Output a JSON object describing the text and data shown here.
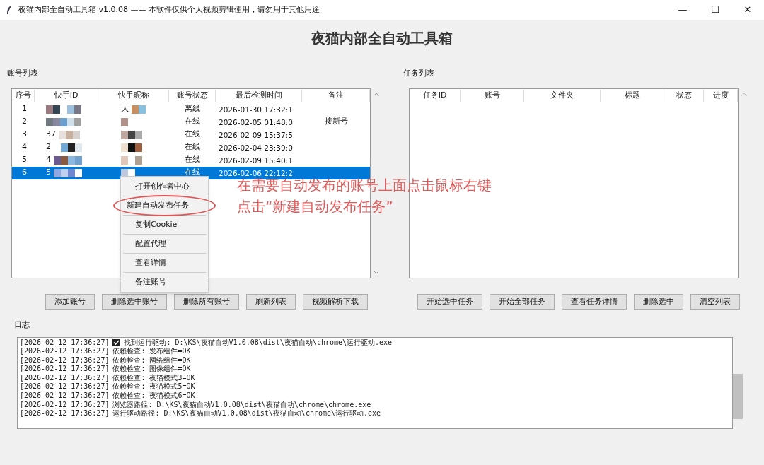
{
  "window": {
    "title": "夜猫内部全自动工具箱 v1.0.08 —— 本软件仅供个人视频剪辑使用，请勿用于其他用途",
    "controls": [
      "—",
      "☐",
      "✕"
    ]
  },
  "heading": "夜猫内部全自动工具箱",
  "accounts": {
    "label": "账号列表",
    "columns": [
      "序号",
      "快手ID",
      "快手昵称",
      "账号状态",
      "最后检测时间",
      "备注"
    ],
    "rows": [
      {
        "index": "1",
        "id_fragment": "",
        "nick_fragment": "大",
        "status": "离线",
        "time": "2026-01-30 17:32:1",
        "note": "",
        "selected": false
      },
      {
        "index": "2",
        "id_fragment": "",
        "nick_fragment": "",
        "status": "在线",
        "time": "2026-02-05 01:48:0",
        "note": "接新号",
        "selected": false
      },
      {
        "index": "3",
        "id_fragment": "37",
        "nick_fragment": "",
        "status": "在线",
        "time": "2026-02-09 15:37:5",
        "note": "",
        "selected": false
      },
      {
        "index": "4",
        "id_fragment": "2",
        "nick_fragment": "",
        "status": "在线",
        "time": "2026-02-04 23:39:0",
        "note": "",
        "selected": false
      },
      {
        "index": "5",
        "id_fragment": "4",
        "nick_fragment": "",
        "status": "在线",
        "time": "2026-02-09 15:40:1",
        "note": "",
        "selected": false
      },
      {
        "index": "6",
        "id_fragment": "5",
        "nick_fragment": "",
        "status": "在线",
        "time": "2026-02-06 22:12:2",
        "note": "",
        "selected": true
      }
    ],
    "buttons": [
      "添加账号",
      "删除选中账号",
      "删除所有账号",
      "刷新列表",
      "视频解析下载"
    ]
  },
  "context_menu": [
    {
      "label": "打开创作者中心",
      "circled": false
    },
    {
      "label": "新建自动发布任务",
      "circled": true
    },
    {
      "label": "复制Cookie",
      "circled": false
    },
    {
      "label": "配置代理",
      "circled": false
    },
    {
      "label": "查看详情",
      "circled": false
    },
    {
      "label": "备注账号",
      "circled": false
    }
  ],
  "annotation": [
    "在需要自动发布的账号上面点击鼠标右键",
    "点击“新建自动发布任务”"
  ],
  "tasks": {
    "label": "任务列表",
    "columns": [
      "任务ID",
      "账号",
      "文件夹",
      "标题",
      "状态",
      "进度"
    ],
    "buttons": [
      "开始选中任务",
      "开始全部任务",
      "查看任务详情",
      "删除选中",
      "清空列表"
    ]
  },
  "log": {
    "label": "日志",
    "lines": [
      {
        "time": "[2026-02-12 17:36:27]",
        "check": true,
        "text": "找到运行驱动: D:\\KS\\夜猫自动V1.0.08\\dist\\夜猫自动\\chrome\\运行驱动.exe"
      },
      {
        "time": "[2026-02-12 17:36:27]",
        "check": false,
        "text": "依赖检查: 发布组件=OK"
      },
      {
        "time": "[2026-02-12 17:36:27]",
        "check": false,
        "text": "依赖检查: 网络组件=OK"
      },
      {
        "time": "[2026-02-12 17:36:27]",
        "check": false,
        "text": "依赖检查: 图像组件=OK"
      },
      {
        "time": "[2026-02-12 17:36:27]",
        "check": false,
        "text": "依赖检查: 夜猫模式3=OK"
      },
      {
        "time": "[2026-02-12 17:36:27]",
        "check": false,
        "text": "依赖检查: 夜猫模式5=OK"
      },
      {
        "time": "[2026-02-12 17:36:27]",
        "check": false,
        "text": "依赖检查: 夜猫模式6=OK"
      },
      {
        "time": "[2026-02-12 17:36:27]",
        "check": false,
        "text": "浏览器路径: D:\\KS\\夜猫自动V1.0.08\\dist\\夜猫自动\\chrome\\chrome.exe"
      },
      {
        "time": "[2026-02-12 17:36:27]",
        "check": false,
        "text": "运行驱动路径: D:\\KS\\夜猫自动V1.0.08\\dist\\夜猫自动\\chrome\\运行驱动.exe"
      }
    ]
  }
}
